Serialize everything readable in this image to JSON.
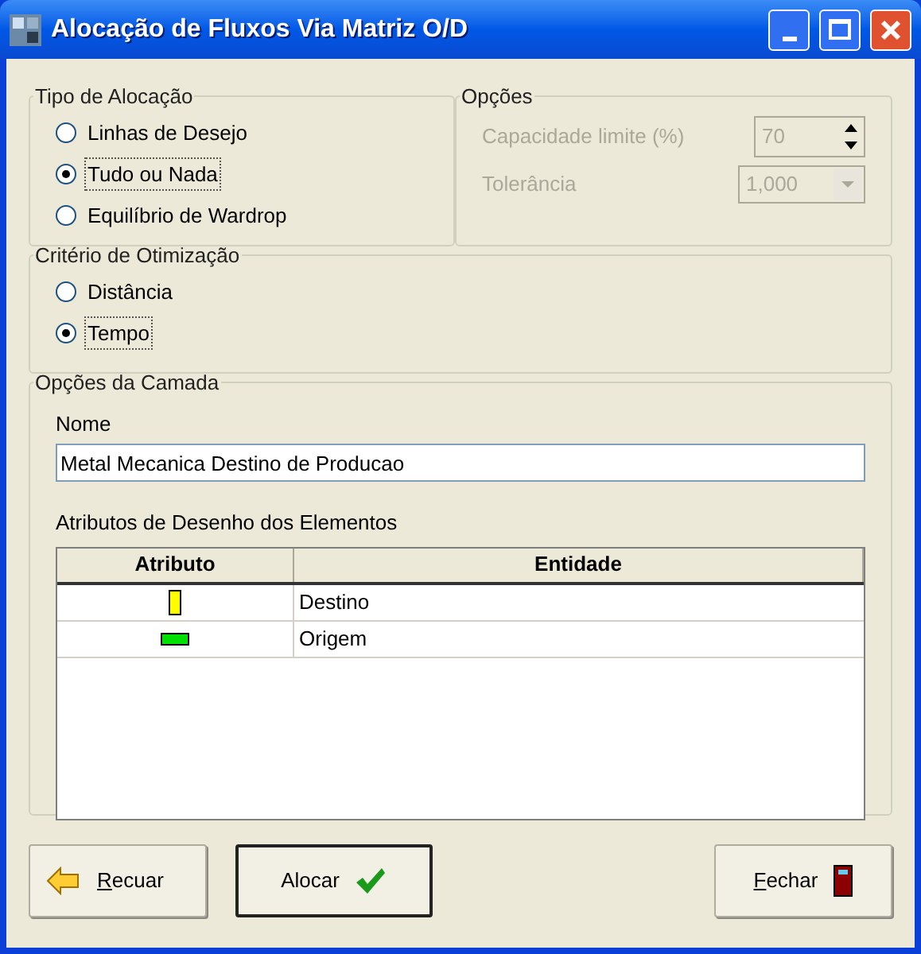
{
  "window": {
    "title": "Alocação de Fluxos Via Matriz O/D"
  },
  "allocation_type": {
    "title": "Tipo de Alocação",
    "options": [
      {
        "label": "Linhas de Desejo",
        "selected": false
      },
      {
        "label": "Tudo ou Nada",
        "selected": true
      },
      {
        "label": "Equilíbrio de Wardrop",
        "selected": false
      }
    ]
  },
  "options": {
    "title": "Opções",
    "fields": [
      {
        "kind": "spin",
        "label": "Capacidade limite (%)",
        "value": "70",
        "disabled": true
      },
      {
        "kind": "dropdown",
        "label": "Tolerância",
        "value": "1,000",
        "disabled": true
      }
    ]
  },
  "optimization": {
    "title": "Critério de Otimização",
    "options": [
      {
        "label": "Distância",
        "selected": false
      },
      {
        "label": "Tempo",
        "selected": true
      }
    ]
  },
  "layer": {
    "title": "Opções da Camada",
    "name_label": "Nome",
    "name_value": "Metal Mecanica Destino de Producao",
    "table_label": "Atributos de Desenho dos Elementos",
    "table": {
      "columns": [
        "Atributo",
        "Entidade"
      ],
      "rows": [
        {
          "kind": "tall",
          "color": "#ffff00",
          "entity": "Destino"
        },
        {
          "kind": "wide",
          "color": "#00e000",
          "entity": "Origem"
        }
      ]
    }
  },
  "buttons": [
    {
      "kind": "back",
      "label": "Recuar",
      "underline_first": true,
      "default": false
    },
    {
      "kind": "ok",
      "label": "Alocar",
      "underline_first": false,
      "default": true
    },
    {
      "kind": "close",
      "label": "Fechar",
      "underline_first": true,
      "default": false
    }
  ]
}
